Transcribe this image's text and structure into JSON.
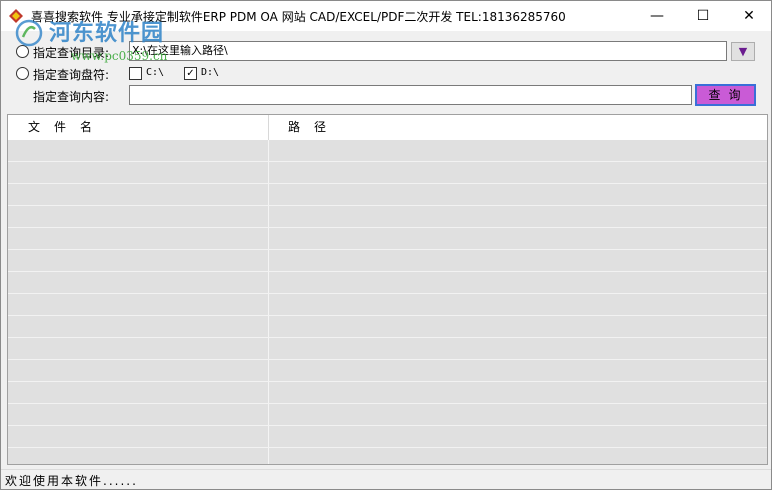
{
  "window": {
    "title": "喜喜搜索软件    专业承接定制软件ERP PDM OA 网站 CAD/EXCEL/PDF二次开发  TEL:18136285760",
    "controls": {
      "minimize": "—",
      "maximize": "☐",
      "close": "✕"
    }
  },
  "watermark": {
    "text": "河东软件园",
    "url": "www.pc0359.cn"
  },
  "form": {
    "dir_option_label": "指定查询目录:",
    "dir_value": "X:\\在这里输入路径\\",
    "browse_glyph": "▼",
    "drive_option_label": "指定查询盘符:",
    "drives": [
      {
        "label": "C:\\",
        "checked": false
      },
      {
        "label": "D:\\",
        "checked": true
      }
    ],
    "content_label": "指定查询内容:",
    "content_value": "",
    "search_button": "查询"
  },
  "table": {
    "columns": [
      "文件名",
      "路径"
    ],
    "rows": [
      [
        "",
        ""
      ],
      [
        "",
        ""
      ],
      [
        "",
        ""
      ],
      [
        "",
        ""
      ],
      [
        "",
        ""
      ],
      [
        "",
        ""
      ],
      [
        "",
        ""
      ],
      [
        "",
        ""
      ],
      [
        "",
        ""
      ],
      [
        "",
        ""
      ],
      [
        "",
        ""
      ],
      [
        "",
        ""
      ],
      [
        "",
        ""
      ],
      [
        "",
        ""
      ],
      [
        "",
        ""
      ]
    ]
  },
  "status": {
    "text": "欢迎使用本软件......"
  },
  "colors": {
    "row_bg": "#e0e0e0",
    "search_btn": "#c95bd6",
    "search_btn_border": "#3a6fd8",
    "browse_arrow": "#6a1c8f"
  }
}
